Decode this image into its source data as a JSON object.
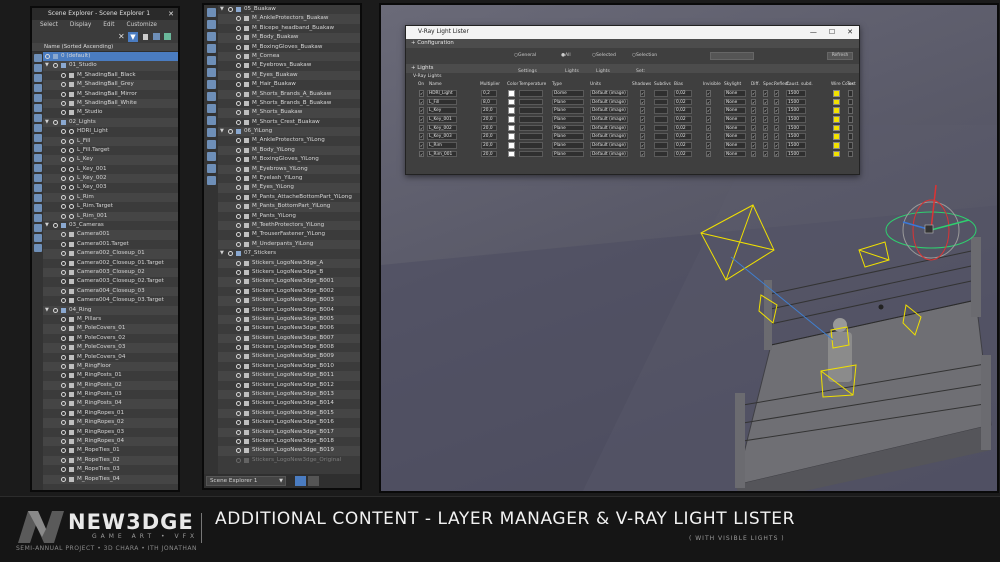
{
  "scene_explorer_1": {
    "title": "Scene Explorer - Scene Explorer 1",
    "menu": [
      "Select",
      "Display",
      "Edit",
      "Customize"
    ],
    "column_header": "Name (Sorted Ascending)",
    "items": [
      {
        "label": "0 (default)",
        "level": 0,
        "type": "layer",
        "selected": true
      },
      {
        "label": "01_Studio",
        "level": 1,
        "type": "layer"
      },
      {
        "label": "M_ShadingBall_Black",
        "level": 2,
        "type": "obj"
      },
      {
        "label": "M_ShadingBall_Grey",
        "level": 2,
        "type": "obj"
      },
      {
        "label": "M_ShadingBall_Mirror",
        "level": 2,
        "type": "obj"
      },
      {
        "label": "M_ShadingBall_White",
        "level": 2,
        "type": "obj"
      },
      {
        "label": "M_Studio",
        "level": 2,
        "type": "obj"
      },
      {
        "label": "02_Lights",
        "level": 1,
        "type": "layer"
      },
      {
        "label": "HDRI_Light",
        "level": 2,
        "type": "light"
      },
      {
        "label": "L_Fill",
        "level": 2,
        "type": "light"
      },
      {
        "label": "L_Fill.Target",
        "level": 2,
        "type": "light"
      },
      {
        "label": "L_Key",
        "level": 2,
        "type": "light"
      },
      {
        "label": "L_Key_001",
        "level": 2,
        "type": "light"
      },
      {
        "label": "L_Key_002",
        "level": 2,
        "type": "light"
      },
      {
        "label": "L_Key_003",
        "level": 2,
        "type": "light"
      },
      {
        "label": "L_Rim",
        "level": 2,
        "type": "light"
      },
      {
        "label": "L_Rim.Target",
        "level": 2,
        "type": "light"
      },
      {
        "label": "L_Rim_001",
        "level": 2,
        "type": "light"
      },
      {
        "label": "03_Cameras",
        "level": 1,
        "type": "layer"
      },
      {
        "label": "Camera001",
        "level": 2,
        "type": "cam"
      },
      {
        "label": "Camera001.Target",
        "level": 2,
        "type": "cam"
      },
      {
        "label": "Camera002_Closeup_01",
        "level": 2,
        "type": "cam"
      },
      {
        "label": "Camera002_Closeup_01.Target",
        "level": 2,
        "type": "cam"
      },
      {
        "label": "Camera003_Closeup_02",
        "level": 2,
        "type": "cam"
      },
      {
        "label": "Camera003_Closeup_02.Target",
        "level": 2,
        "type": "cam"
      },
      {
        "label": "Camera004_Closeup_03",
        "level": 2,
        "type": "cam"
      },
      {
        "label": "Camera004_Closeup_03.Target",
        "level": 2,
        "type": "cam"
      },
      {
        "label": "04_Ring",
        "level": 1,
        "type": "layer"
      },
      {
        "label": "M_Pillars",
        "level": 2,
        "type": "obj"
      },
      {
        "label": "M_PoleCovers_01",
        "level": 2,
        "type": "obj"
      },
      {
        "label": "M_PoleCovers_02",
        "level": 2,
        "type": "obj"
      },
      {
        "label": "M_PoleCovers_03",
        "level": 2,
        "type": "obj"
      },
      {
        "label": "M_PoleCovers_04",
        "level": 2,
        "type": "obj"
      },
      {
        "label": "M_RingFloor",
        "level": 2,
        "type": "obj"
      },
      {
        "label": "M_RingPosts_01",
        "level": 2,
        "type": "obj"
      },
      {
        "label": "M_RingPosts_02",
        "level": 2,
        "type": "obj"
      },
      {
        "label": "M_RingPosts_03",
        "level": 2,
        "type": "obj"
      },
      {
        "label": "M_RingPosts_04",
        "level": 2,
        "type": "obj"
      },
      {
        "label": "M_RingRopes_01",
        "level": 2,
        "type": "obj"
      },
      {
        "label": "M_RingRopes_02",
        "level": 2,
        "type": "obj"
      },
      {
        "label": "M_RingRopes_03",
        "level": 2,
        "type": "obj"
      },
      {
        "label": "M_RingRopes_04",
        "level": 2,
        "type": "obj"
      },
      {
        "label": "M_RopeTies_01",
        "level": 2,
        "type": "obj"
      },
      {
        "label": "M_RopeTies_02",
        "level": 2,
        "type": "obj"
      },
      {
        "label": "M_RopeTies_03",
        "level": 2,
        "type": "obj"
      },
      {
        "label": "M_RopeTies_04",
        "level": 2,
        "type": "obj"
      }
    ]
  },
  "scene_explorer_2": {
    "footer_dropdown": "Scene Explorer 1",
    "items": [
      {
        "label": "05_Buakaw",
        "level": 1,
        "type": "layer"
      },
      {
        "label": "M_AnkleProtectors_Buakaw",
        "level": 2,
        "type": "obj"
      },
      {
        "label": "M_Bicepe_headband_Buakaw",
        "level": 2,
        "type": "obj"
      },
      {
        "label": "M_Body_Buakaw",
        "level": 2,
        "type": "obj"
      },
      {
        "label": "M_BoxingGloves_Buakaw",
        "level": 2,
        "type": "obj"
      },
      {
        "label": "M_Cornea",
        "level": 2,
        "type": "obj"
      },
      {
        "label": "M_Eyebrows_Buakaw",
        "level": 2,
        "type": "obj"
      },
      {
        "label": "M_Eyes_Buakaw",
        "level": 2,
        "type": "obj"
      },
      {
        "label": "M_Hair_Buakaw",
        "level": 2,
        "type": "obj"
      },
      {
        "label": "M_Shorts_Brands_A_Buakaw",
        "level": 2,
        "type": "obj"
      },
      {
        "label": "M_Shorts_Brands_B_Buakaw",
        "level": 2,
        "type": "obj"
      },
      {
        "label": "M_Shorts_Buakaw",
        "level": 2,
        "type": "obj"
      },
      {
        "label": "M_Shorts_Crest_Buakaw",
        "level": 2,
        "type": "obj"
      },
      {
        "label": "06_YiLong",
        "level": 1,
        "type": "layer"
      },
      {
        "label": "M_AnkleProtectors_YiLong",
        "level": 2,
        "type": "obj"
      },
      {
        "label": "M_Body_YiLong",
        "level": 2,
        "type": "obj"
      },
      {
        "label": "M_BoxingGloves_YiLong",
        "level": 2,
        "type": "obj"
      },
      {
        "label": "M_Eyebrows_YiLong",
        "level": 2,
        "type": "obj"
      },
      {
        "label": "M_Eyelash_YiLong",
        "level": 2,
        "type": "obj"
      },
      {
        "label": "M_Eyes_YiLong",
        "level": 2,
        "type": "obj"
      },
      {
        "label": "M_Pants_AttacheBottomPart_YiLong",
        "level": 2,
        "type": "obj"
      },
      {
        "label": "M_Pants_BottomPart_YiLong",
        "level": 2,
        "type": "obj"
      },
      {
        "label": "M_Pants_YiLong",
        "level": 2,
        "type": "obj"
      },
      {
        "label": "M_TeethProtectors_YiLong",
        "level": 2,
        "type": "obj"
      },
      {
        "label": "M_TrouserFastener_YiLong",
        "level": 2,
        "type": "obj"
      },
      {
        "label": "M_Underpants_YiLong",
        "level": 2,
        "type": "obj"
      },
      {
        "label": "07_Stickers",
        "level": 1,
        "type": "layer"
      },
      {
        "label": "Stickers_LogoNew3dge_A",
        "level": 2,
        "type": "obj"
      },
      {
        "label": "Stickers_LogoNew3dge_B",
        "level": 2,
        "type": "obj"
      },
      {
        "label": "Stickers_LogoNew3dge_B001",
        "level": 2,
        "type": "obj"
      },
      {
        "label": "Stickers_LogoNew3dge_B002",
        "level": 2,
        "type": "obj"
      },
      {
        "label": "Stickers_LogoNew3dge_B003",
        "level": 2,
        "type": "obj"
      },
      {
        "label": "Stickers_LogoNew3dge_B004",
        "level": 2,
        "type": "obj"
      },
      {
        "label": "Stickers_LogoNew3dge_B005",
        "level": 2,
        "type": "obj"
      },
      {
        "label": "Stickers_LogoNew3dge_B006",
        "level": 2,
        "type": "obj"
      },
      {
        "label": "Stickers_LogoNew3dge_B007",
        "level": 2,
        "type": "obj"
      },
      {
        "label": "Stickers_LogoNew3dge_B008",
        "level": 2,
        "type": "obj"
      },
      {
        "label": "Stickers_LogoNew3dge_B009",
        "level": 2,
        "type": "obj"
      },
      {
        "label": "Stickers_LogoNew3dge_B010",
        "level": 2,
        "type": "obj"
      },
      {
        "label": "Stickers_LogoNew3dge_B011",
        "level": 2,
        "type": "obj"
      },
      {
        "label": "Stickers_LogoNew3dge_B012",
        "level": 2,
        "type": "obj"
      },
      {
        "label": "Stickers_LogoNew3dge_B013",
        "level": 2,
        "type": "obj"
      },
      {
        "label": "Stickers_LogoNew3dge_B014",
        "level": 2,
        "type": "obj"
      },
      {
        "label": "Stickers_LogoNew3dge_B015",
        "level": 2,
        "type": "obj"
      },
      {
        "label": "Stickers_LogoNew3dge_B016",
        "level": 2,
        "type": "obj"
      },
      {
        "label": "Stickers_LogoNew3dge_B017",
        "level": 2,
        "type": "obj"
      },
      {
        "label": "Stickers_LogoNew3dge_B018",
        "level": 2,
        "type": "obj"
      },
      {
        "label": "Stickers_LogoNew3dge_B019",
        "level": 2,
        "type": "obj"
      },
      {
        "label": "Stickers_LogoNew3dge_Original",
        "level": 2,
        "type": "hidden"
      }
    ]
  },
  "vray_light_lister": {
    "title": "V-Ray Light Lister",
    "window_controls": [
      "—",
      "☐",
      "✕"
    ],
    "configuration_label": "Configuration",
    "options": [
      "General Settings",
      "All Lights",
      "Selected Lights",
      "Selection Set:"
    ],
    "refresh_label": "Refresh",
    "lights_label": "Lights",
    "group_label": "V-Ray Lights",
    "columns": [
      "On",
      "Name",
      "Multiplier",
      "Color",
      "Temperature",
      "Type",
      "Units",
      "Shadows",
      "Subdivs",
      "Bias",
      "Invisible",
      "Skylight",
      "Diff.",
      "Spec.",
      "Reflect.",
      "Caust. subd.",
      "Wire Color",
      "Text"
    ],
    "lights": [
      {
        "name": "HDRI_Light",
        "multiplier": "0,2",
        "type": "Dome",
        "units": "Default (image)",
        "bias": "0,02",
        "skylight": "None",
        "caust": "1500"
      },
      {
        "name": "L_Fill",
        "multiplier": "8,0",
        "type": "Plane",
        "units": "Default (image)",
        "bias": "0,02",
        "skylight": "None",
        "caust": "1500"
      },
      {
        "name": "L_Key",
        "multiplier": "20,0",
        "type": "Plane",
        "units": "Default (image)",
        "bias": "0,02",
        "skylight": "None",
        "caust": "1500"
      },
      {
        "name": "L_Key_001",
        "multiplier": "20,0",
        "type": "Plane",
        "units": "Default (image)",
        "bias": "0,02",
        "skylight": "None",
        "caust": "1500"
      },
      {
        "name": "L_Key_002",
        "multiplier": "20,0",
        "type": "Plane",
        "units": "Default (image)",
        "bias": "0,02",
        "skylight": "None",
        "caust": "1500"
      },
      {
        "name": "L_Key_003",
        "multiplier": "20,0",
        "type": "Plane",
        "units": "Default (image)",
        "bias": "0,02",
        "skylight": "None",
        "caust": "1500"
      },
      {
        "name": "L_Rim",
        "multiplier": "20,0",
        "type": "Plane",
        "units": "Default (image)",
        "bias": "0,02",
        "skylight": "None",
        "caust": "1500"
      },
      {
        "name": "L_Rim_001",
        "multiplier": "20,0",
        "type": "Plane",
        "units": "Default (image)",
        "bias": "0,02",
        "skylight": "None",
        "caust": "1500"
      }
    ]
  },
  "banner": {
    "logo_text": "NEW3DGE",
    "logo_sub": "GAME ART • VFX",
    "logo_credit": "SEMI-ANNUAL PROJECT • 3D CHARA • ITH JONATHAN",
    "title": "ADDITIONAL CONTENT - LAYER MANAGER & V-RAY LIGHT LISTER",
    "subtitle": "( WITH VISIBLE LIGHTS )"
  },
  "colors": {
    "selection": "#4a7cc1",
    "panel": "#3b3b3b",
    "light_gizmo": "#f0e000",
    "accent_icon": "#6e8fb8"
  }
}
